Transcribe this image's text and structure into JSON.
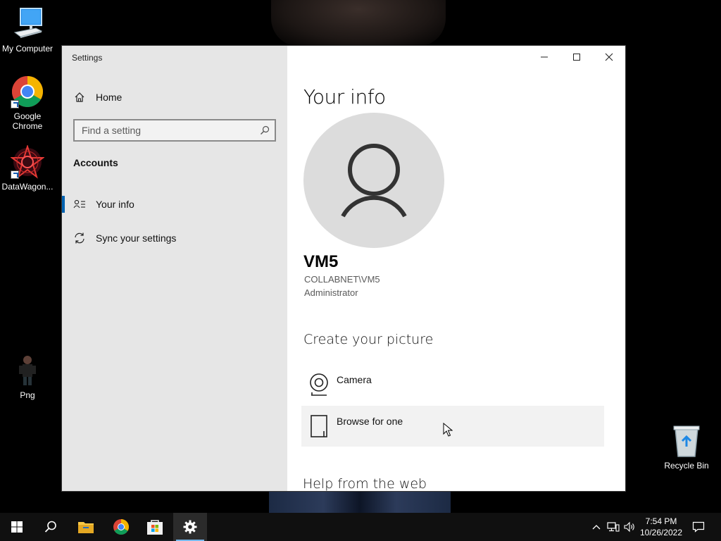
{
  "desktop": {
    "icons": [
      {
        "label": "My Computer",
        "icon": "computer-icon"
      },
      {
        "label": "Google Chrome",
        "icon": "chrome-icon"
      },
      {
        "label": "DataWagon...",
        "icon": "datawagon-icon"
      },
      {
        "label": "Png",
        "icon": "image-file-icon"
      },
      {
        "label": "Recycle Bin",
        "icon": "recycle-bin-icon"
      }
    ]
  },
  "window": {
    "title": "Settings",
    "controls": [
      "minimize-icon",
      "maximize-icon",
      "close-icon"
    ]
  },
  "sidebar": {
    "home_label": "Home",
    "search_placeholder": "Find a setting",
    "section_title": "Accounts",
    "items": [
      {
        "label": "Your info",
        "icon": "person-list-icon",
        "active": true
      },
      {
        "label": "Sync your settings",
        "icon": "sync-icon",
        "active": false
      }
    ]
  },
  "main": {
    "title": "Your info",
    "user": {
      "name": "VM5",
      "account": "COLLABNET\\VM5",
      "role": "Administrator"
    },
    "create_picture": {
      "heading": "Create your picture",
      "options": [
        {
          "label": "Camera",
          "icon": "camera-icon"
        },
        {
          "label": "Browse for one",
          "icon": "browse-file-icon"
        }
      ]
    },
    "help_heading": "Help from the web"
  },
  "taskbar": {
    "apps": [
      "start-icon",
      "search-icon",
      "file-explorer-icon",
      "chrome-icon",
      "store-icon",
      "settings-gear-icon"
    ],
    "clock": {
      "time": "7:54 PM",
      "date": "10/26/2022"
    }
  },
  "colors": {
    "accent": "#0063b1",
    "sidebar_bg": "#e6e6e6",
    "taskbar_bg": "#101010"
  }
}
